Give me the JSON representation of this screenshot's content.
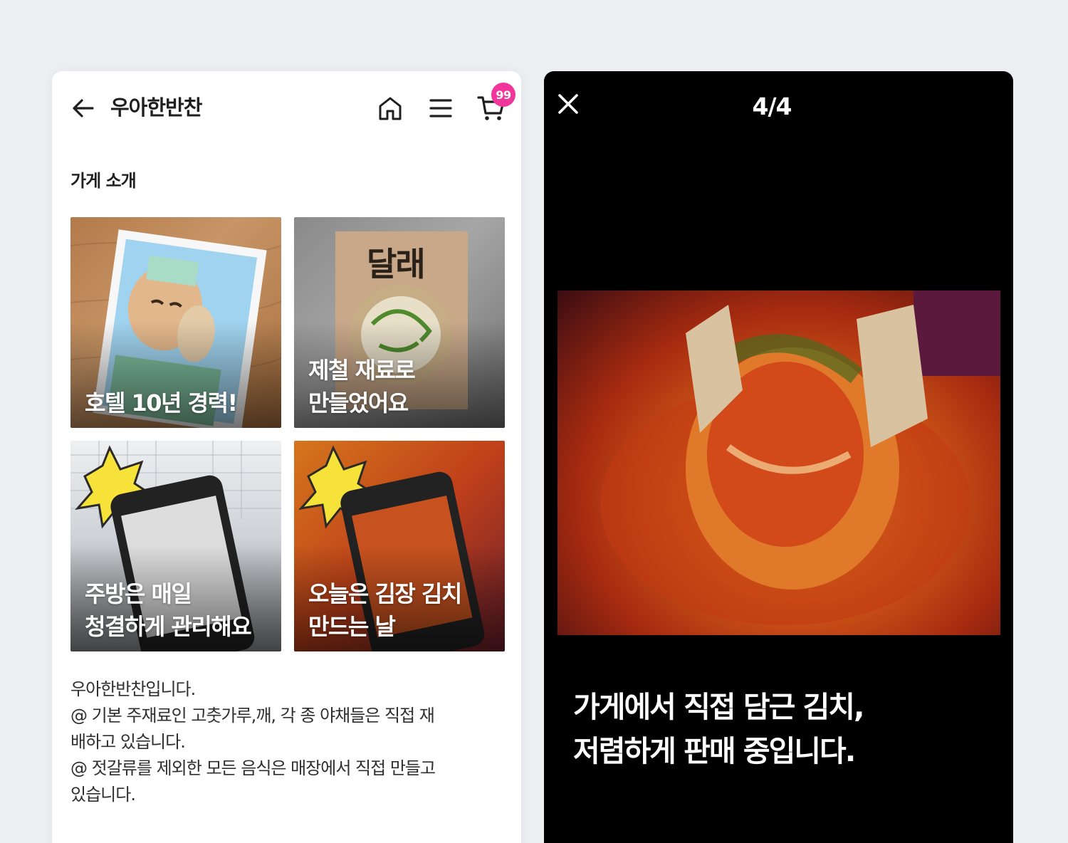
{
  "store": {
    "title": "우아한반찬",
    "cart_count": "99"
  },
  "intro": {
    "section_title": "가게 소개",
    "tiles": [
      {
        "caption_line1": "호텔 10년 경력!",
        "caption_line2": ""
      },
      {
        "caption_line1": "제철 재료로",
        "caption_line2": "만들었어요",
        "sign_text": "달래"
      },
      {
        "caption_line1": "주방은 매일",
        "caption_line2": "청결하게 관리해요"
      },
      {
        "caption_line1": "오늘은 김장 김치",
        "caption_line2": "만드는 날"
      }
    ],
    "description": [
      "우아한반찬입니다.",
      "@ 기본 주재료인 고춧가루,깨, 각 종 야채들은 직접 재",
      "배하고 있습니다.",
      "@ 젓갈류를 제외한 모든 음식은 매장에서 직접 만들고",
      "있습니다."
    ]
  },
  "viewer": {
    "counter": "4/4",
    "caption_line1": "가게에서 직접 담근 김치,",
    "caption_line2": "저렴하게 판매 중입니다."
  },
  "colors": {
    "badge": "#f0359b",
    "page_bg": "#eceef2",
    "viewer_bg": "#000000"
  },
  "icons": [
    "back-arrow-icon",
    "home-icon",
    "menu-icon",
    "cart-icon",
    "close-icon"
  ]
}
